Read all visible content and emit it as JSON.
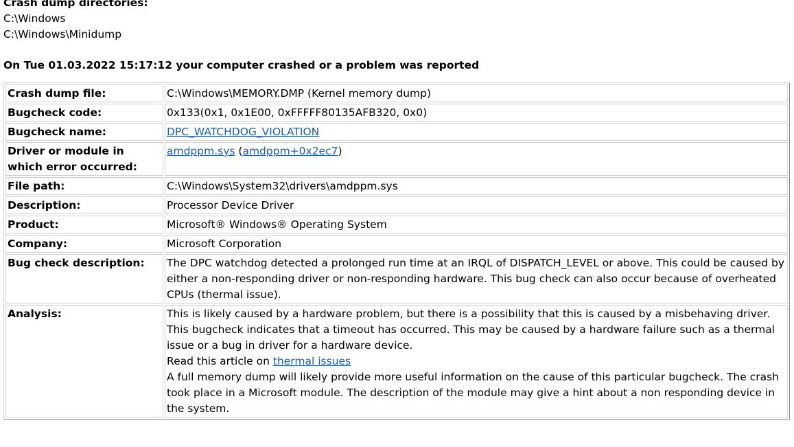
{
  "dirs": {
    "heading": "Crash dump directories:",
    "items": [
      "C:\\Windows",
      "C:\\Windows\\Minidump"
    ]
  },
  "crash_title": "On Tue 01.03.2022 15:17:12 your computer crashed or a problem was reported",
  "rows": {
    "dump_file": {
      "label": "Crash dump file:",
      "value": "C:\\Windows\\MEMORY.DMP (Kernel memory dump)"
    },
    "bugcheck_code": {
      "label": "Bugcheck code:",
      "value": "0x133(0x1, 0x1E00, 0xFFFFF80135AFB320, 0x0)"
    },
    "bugcheck_name": {
      "label": "Bugcheck name:",
      "link": "DPC_WATCHDOG_VIOLATION"
    },
    "driver": {
      "label": "Driver or module in which error occurred:",
      "link": "amdppm.sys",
      "open": " (",
      "link2": "amdppm+0x2ec7",
      "close": ")"
    },
    "file_path": {
      "label": "File path:",
      "value": "C:\\Windows\\System32\\drivers\\amdppm.sys"
    },
    "description": {
      "label": "Description:",
      "value": "Processor Device Driver"
    },
    "product": {
      "label": "Product:",
      "value": "Microsoft® Windows® Operating System"
    },
    "company": {
      "label": "Company:",
      "value": "Microsoft Corporation"
    },
    "bug_desc": {
      "label": "Bug check description:",
      "value": "The DPC watchdog detected a prolonged run time at an IRQL of DISPATCH_LEVEL or above. This could be caused by either a non-responding driver or non-responding hardware. This bug check can also occur because of overheated CPUs (thermal issue)."
    },
    "analysis": {
      "label": "Analysis:",
      "p1": "This is likely caused by a hardware problem, but there is a possibility that this is caused by a misbehaving driver.",
      "p2": "This bugcheck indicates that a timeout has occurred. This may be caused by a hardware failure such as a thermal issue or a bug in driver for a hardware device.",
      "p3_prefix": "Read this article on ",
      "p3_link": "thermal issues",
      "p4": "A full memory dump will likely provide more useful information on the cause of this particular bugcheck. The crash took place in a Microsoft module. The description of the module may give a hint about a non responding device in the system."
    }
  },
  "colors": {
    "link": "#1a5fb4",
    "border": "#cfcfcf"
  }
}
